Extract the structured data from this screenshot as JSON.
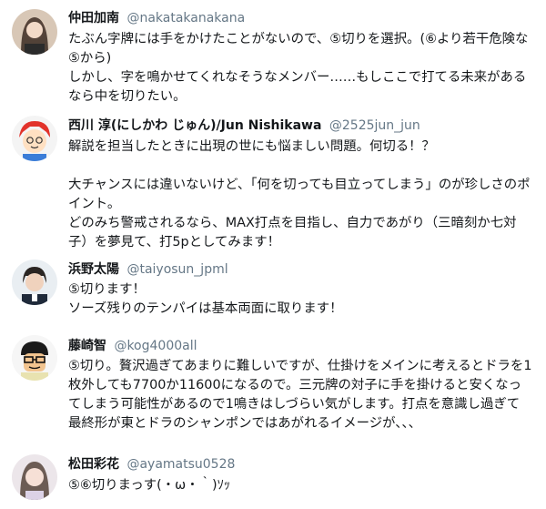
{
  "tweets": [
    {
      "name": "仲田加南",
      "handle": "@nakatakanakana",
      "text": "たぶん字牌には手をかけたことがないので、⑤切りを選択。(⑥より若干危険な⑤から)\nしかし、字を鳴かせてくれなそうなメンバー……もしここで打てる未来があるなら中を切りたい。"
    },
    {
      "name": "西川 淳(にしかわ じゅん)/Jun Nishikawa",
      "handle": "@2525jun_jun",
      "text": "解説を担当したときに出現の世にも悩ましい問題。何切る！？\n\n大チャンスには違いないけど、「何を切っても目立ってしまう」のが珍しさのポイント。\nどのみち警戒されるなら、MAX打点を目指し、自力であがり（三暗刻か七対子）を夢見て、打5pとしてみます！"
    },
    {
      "name": "浜野太陽",
      "handle": "@taiyosun_jpml",
      "text": "⑤切ります！\nソーズ残りのテンパイは基本両面に取ります！"
    },
    {
      "name": "藤崎智",
      "handle": "@kog4000all",
      "text": "⑤切り。贅沢過ぎてあまりに難しいですが、仕掛けをメインに考えるとドラを1枚外しても7700か11600になるので。三元牌の対子に手を掛けると安くなってしまう可能性があるので1鳴きはしづらい気がします。打点を意識し過ぎて最終形が東とドラのシャンポンではあがれるイメージが、、、"
    },
    {
      "name": "松田彩花",
      "handle": "@ayamatsu0528",
      "text": "⑤⑥切りまっす(・ω・｀)ｿｯ"
    }
  ]
}
